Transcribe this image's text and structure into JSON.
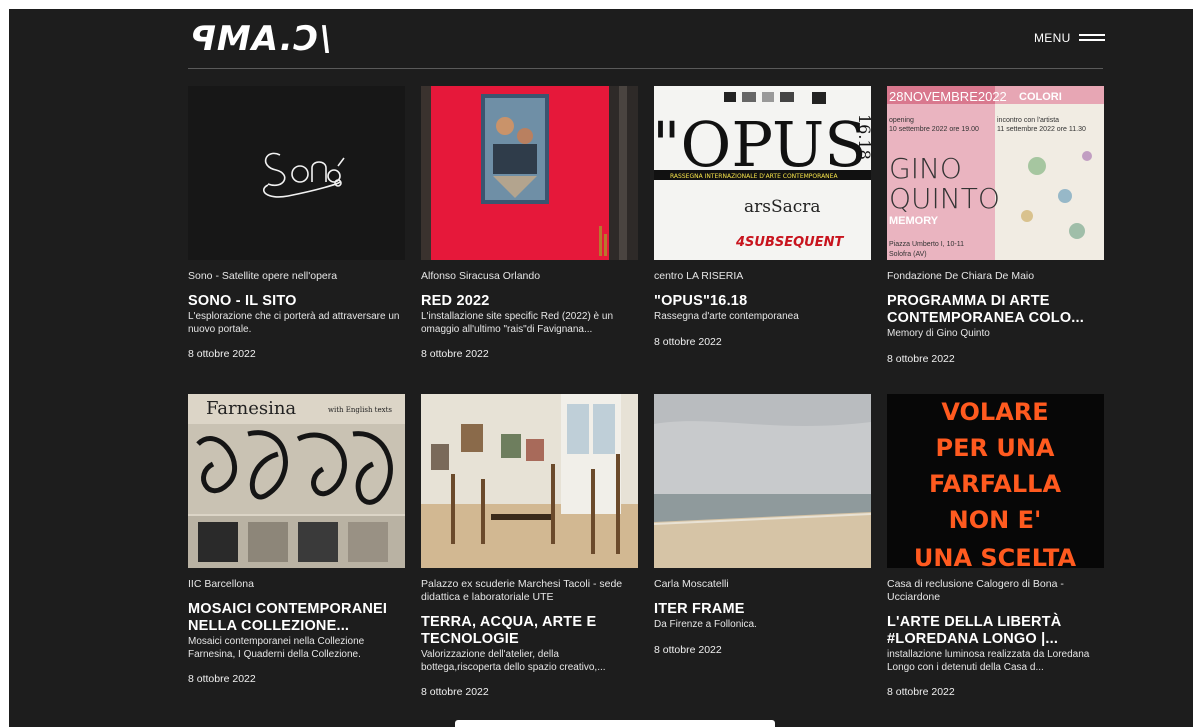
{
  "header": {
    "logo": "ꟼMA.Ɔ\\",
    "menu_label": "MENU"
  },
  "cards": [
    {
      "venue": "Sono - Satellite opere nell'opera",
      "title": "SONO - IL SITO",
      "desc": "L'esplorazione che ci porterà ad attraversare un nuovo portale.",
      "date": "8 ottobre 2022",
      "thumb_text": "Sonō"
    },
    {
      "venue": "Alfonso Siracusa Orlando",
      "title": "RED 2022",
      "desc": "L'installazione site specific Red (2022) è un omaggio all'ultimo \"rais\"di Favignana...",
      "date": "8 ottobre 2022"
    },
    {
      "venue": "centro LA RISERIA",
      "title": "\"OPUS\"16.18",
      "desc": "Rassegna d'arte contemporanea",
      "date": "8 ottobre 2022",
      "thumb": {
        "main": "\"OPUS\"",
        "side": "16.18",
        "band": "RASSEGNA INTERNAZIONALE D'ARTE CONTEMPORANEA",
        "sacra": "arsSacra",
        "sub": "4SUBSEQUENT"
      }
    },
    {
      "venue": "Fondazione De Chiara De Maio",
      "title": "PROGRAMMA DI ARTE CONTEMPORANEA COLO...",
      "desc": "Memory di Gino Quinto",
      "date": "8 ottobre 2022",
      "thumb": {
        "date": "28NOVEMBRE2022",
        "colori": "COLORI",
        "opening": "opening\n10 settembre 2022 ore 19.00",
        "incontro": "incontro con l'artista\n11 settembre 2022 ore 11.30",
        "name1": "GINO",
        "name2": "QUINTO",
        "memory": "MEMORY",
        "address": "Piazza Umberto I, 10-11\nSolofra (AV)"
      }
    },
    {
      "venue": "IIC Barcellona",
      "title": "MOSAICI CONTEMPORANEI NELLA COLLEZIONE...",
      "desc": "Mosaici contemporanei nella Collezione Farnesina, I Quaderni della Collezione.",
      "date": "8 ottobre 2022",
      "thumb": {
        "title": "Farnesina",
        "sub": "with English texts"
      }
    },
    {
      "venue": "Palazzo ex scuderie Marchesi Tacoli - sede didattica e laboratoriale UTE",
      "title": "TERRA, ACQUA, ARTE E TECNOLOGIE",
      "desc": "Valorizzazione dell'atelier, della bottega,riscoperta dello spazio creativo,...",
      "date": "8 ottobre 2022"
    },
    {
      "venue": "Carla Moscatelli",
      "title": "ITER FRAME",
      "desc": "Da Firenze a Follonica.",
      "date": "8 ottobre 2022"
    },
    {
      "venue": "Casa di reclusione Calogero di Bona - Ucciardone",
      "title": "L'ARTE DELLA LIBERTÀ #LOREDANA LONGO |...",
      "desc": "installazione luminosa realizzata da Loredana Longo con i detenuti della Casa d...",
      "date": "8 ottobre 2022",
      "thumb": {
        "lines": [
          "VOLARE",
          "PER UNA",
          "FARFALLA",
          "NON E'",
          "UNA SCELTA"
        ]
      }
    }
  ],
  "colors": {
    "background": "#1d1d1d",
    "text": "#ffffff",
    "volare_orange": "#ff5a1f",
    "gino_pink": "#e8a8b6"
  }
}
